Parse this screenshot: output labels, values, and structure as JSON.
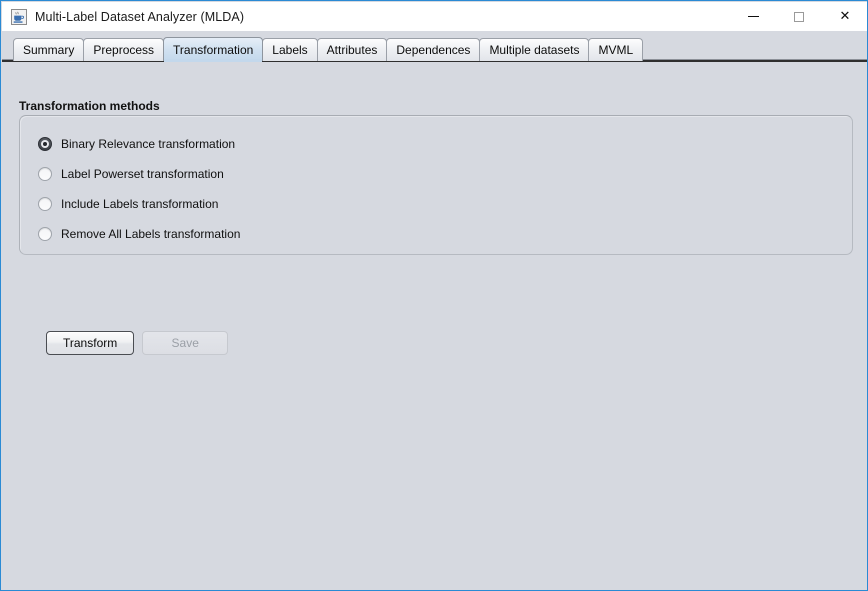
{
  "window": {
    "title": "Multi-Label Dataset Analyzer (MLDA)",
    "app_icon": "java-coffee-cup-icon",
    "border_color": "#2a8ad4",
    "background_color": "#d6d9e0",
    "controls": {
      "minimize_label": "—",
      "maximize_label": "",
      "close_label": "✕"
    }
  },
  "tabs": [
    {
      "label": "Summary",
      "selected": false
    },
    {
      "label": "Preprocess",
      "selected": false
    },
    {
      "label": "Transformation",
      "selected": true
    },
    {
      "label": "Labels",
      "selected": false
    },
    {
      "label": "Attributes",
      "selected": false
    },
    {
      "label": "Dependences",
      "selected": false
    },
    {
      "label": "Multiple datasets",
      "selected": false
    },
    {
      "label": "MVML",
      "selected": false
    }
  ],
  "panel": {
    "title": "Transformation methods",
    "options": [
      {
        "label": "Binary Relevance transformation",
        "selected": true
      },
      {
        "label": "Label Powerset transformation",
        "selected": false
      },
      {
        "label": "Include Labels transformation",
        "selected": false
      },
      {
        "label": "Remove All Labels transformation",
        "selected": false
      }
    ]
  },
  "actions": {
    "transform_label": "Transform",
    "save_label": "Save",
    "save_enabled": false
  }
}
